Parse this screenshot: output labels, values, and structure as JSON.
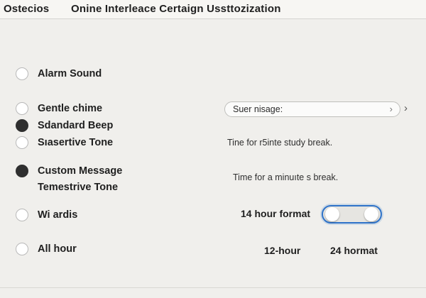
{
  "header": {
    "app_name": "Ostecios",
    "window_title": "Onine  Interleace Certaign  Ussttozization"
  },
  "options": [
    {
      "label": "Alarm Sound",
      "checked": false
    },
    {
      "label": "Gentle chime",
      "checked": false
    },
    {
      "label": "Sdandard Beep",
      "checked": true
    },
    {
      "label": "Sıasertive Tone",
      "checked": false
    },
    {
      "label": "Custom Message",
      "checked": true
    },
    {
      "label": "Temestrive Tone",
      "checked": false
    },
    {
      "label": "Wi ardis",
      "checked": false
    },
    {
      "label": "All hour",
      "checked": false
    }
  ],
  "message_field": {
    "label": "Suer nisage:",
    "chevron_icon": "chevron-right-icon"
  },
  "notes": {
    "study_break": "Tine for r5inte study break.",
    "minute_break": "Time for a minuıte s break."
  },
  "time_format": {
    "label": "14 hour format",
    "toggle_on": false,
    "choice_12": "12-hour",
    "choice_24": "24 hormat"
  },
  "colors": {
    "background": "#f0efec",
    "radio_checked": "#2f2f2f",
    "toggle_focus": "#2f73c9"
  }
}
